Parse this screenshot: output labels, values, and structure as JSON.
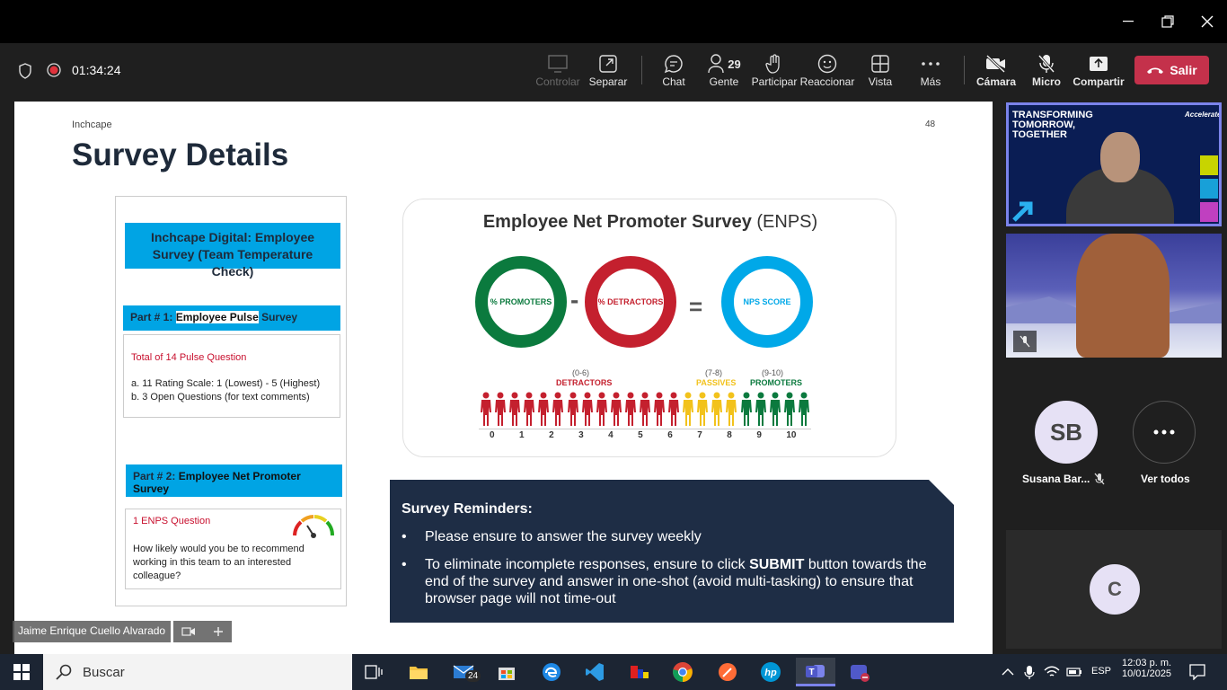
{
  "meeting": {
    "timer": "01:34:24"
  },
  "toolbar": {
    "controlar": "Controlar",
    "separar": "Separar",
    "chat": "Chat",
    "gente": "Gente",
    "gente_count": "29",
    "participar": "Participar",
    "reaccionar": "Reaccionar",
    "vista": "Vista",
    "mas": "Más",
    "camara": "Cámara",
    "micro": "Micro",
    "compartir": "Compartir",
    "salir": "Salir"
  },
  "slide": {
    "brand": "Inchcape",
    "page": "48",
    "title": "Survey Details",
    "header_box": "Inchcape Digital: Employee Survey (Team Temperature Check)",
    "part1_prefix": "Part # 1: ",
    "part1_hl": "Employee Pulse",
    "part1_suffix": " Survey",
    "pulse_total": "Total of 14 Pulse Question",
    "pulse_a": "a.   11 Rating Scale: 1 (Lowest) - 5 (Highest)",
    "pulse_b": "b.   3 Open Questions (for text comments)",
    "part2_prefix": "Part # 2: ",
    "part2_hl": "Employee Net Promoter Survey",
    "enps_q_title": "1 ENPS Question",
    "enps_q_text": "How likely would you be to recommend working in this team to an interested colleague?",
    "enps_title": "Employee Net Promoter Survey",
    "enps_suffix": " (ENPS)",
    "ring_promoters": "% PROMOTERS",
    "ring_detractors": "% DETRACTORS",
    "ring_nps": "NPS SCORE",
    "minus": "-",
    "equals": "=",
    "det_range": "(0-6)",
    "det_label": "DETRACTORS",
    "pas_range": "(7-8)",
    "pas_label": "PASSIVES",
    "pro_range": "(9-10)",
    "pro_label": "PROMOTERS",
    "scale": [
      "0",
      "1",
      "2",
      "3",
      "4",
      "5",
      "6",
      "7",
      "8",
      "9",
      "10"
    ],
    "reminder_title": "Survey Reminders:",
    "reminder_1": "Please ensure to answer the survey weekly",
    "reminder_2a": "To eliminate incomplete responses, ensure to click ",
    "reminder_2b": "SUBMIT",
    "reminder_2c": " button towards the end of the survey and answer in one-shot (avoid multi-tasking) to ensure that browser page will not time-out"
  },
  "presenter_name": "Jaime Enrique Cuello Alvarado",
  "video1_banner": "TRANSFORMING\nTOMORROW,\nTOGETHER",
  "video1_logo": "Accelerate",
  "participants": {
    "sb_initials": "SB",
    "sb_name": "Susana Bar...",
    "ver_todos": "Ver todos",
    "c_initial": "C"
  },
  "taskbar": {
    "search": "Buscar",
    "mail_badge": "24",
    "lang": "ESP",
    "time": "12:03 p. m.",
    "date": "10/01/2025"
  },
  "colors": {
    "promoters": "#0b7a3e",
    "detractors": "#c4202e",
    "passives": "#f2c21b",
    "nps": "#00a8e8",
    "leave": "#c4314b",
    "reminder_bg": "#1e2d45"
  }
}
